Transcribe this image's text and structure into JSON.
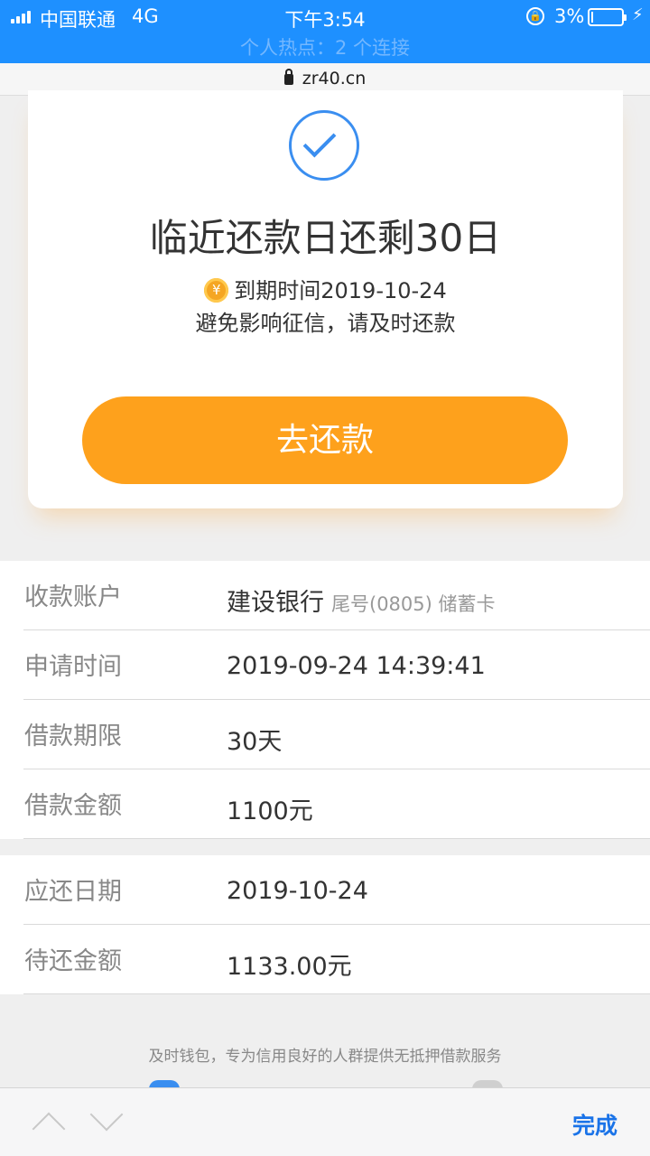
{
  "status_bar": {
    "carrier": "中国联通",
    "network": "4G",
    "time": "下午3:54",
    "battery_percent": "3%",
    "battery_level": 0.03,
    "hotspot": "个人热点：2 个连接"
  },
  "browser": {
    "url": "zr40.cn",
    "done_label": "完成"
  },
  "card": {
    "title": "临近还款日还剩30日",
    "coin_symbol": "¥",
    "due_text": "到期时间2019-10-24",
    "notice": "避免影响征信，请及时还款",
    "button_label": "去还款"
  },
  "details": [
    {
      "label": "收款账户",
      "value": "建设银行",
      "sub": "尾号(0805) 储蓄卡"
    },
    {
      "label": "申请时间",
      "value": "2019-09-24 14:39:41"
    },
    {
      "label": "借款期限",
      "value": "30天"
    },
    {
      "label": "借款金额",
      "value": "1100元"
    }
  ],
  "repayment": [
    {
      "label": "应还日期",
      "value": "2019-10-24"
    },
    {
      "label": "待还金额",
      "value": "1133.00元"
    }
  ],
  "footer_note": "及时钱包，专为信用良好的人群提供无抵押借款服务",
  "colors": {
    "status_bar": "#1e90ff",
    "accent_orange": "#fea11c",
    "check_blue": "#3a8ef0"
  }
}
